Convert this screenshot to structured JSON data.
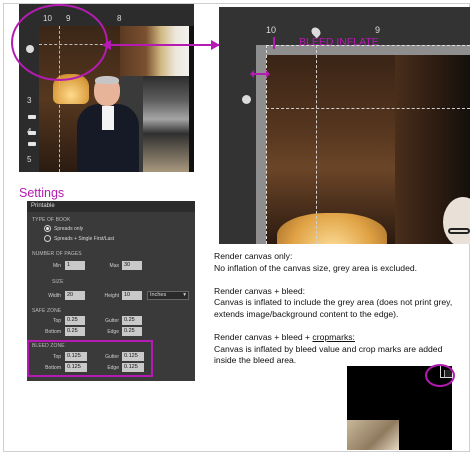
{
  "canvas_preview": {
    "ruler_labels": [
      "10",
      "9",
      "8"
    ],
    "side_labels": [
      "3",
      "4",
      "5"
    ]
  },
  "zoom_preview": {
    "ruler_labels": [
      "10",
      "9"
    ],
    "bleed_label": "BLEED INFLATE"
  },
  "settings": {
    "heading": "Settings",
    "panel_title": "Printable",
    "type_section": "TYPE OF BOOK",
    "type_options": [
      "Spreads only",
      "Spreads + Single First/Last"
    ],
    "pages_section": "NUMBER OF PAGES",
    "min_label": "Min",
    "min_value": "1",
    "max_label": "Max",
    "max_value": "30",
    "size_section": "SIZE",
    "width_label": "Width",
    "width_value": "20",
    "height_label": "Height",
    "height_value": "10",
    "unit_value": "Inches",
    "safe_section": "SAFE ZONE",
    "safe": {
      "top_label": "Top",
      "top_value": "0.25",
      "gutter_label": "Gutter",
      "gutter_value": "0.25",
      "bottom_label": "Bottom",
      "bottom_value": "0.25",
      "edge_label": "Edge",
      "edge_value": "0.25"
    },
    "bleed_section": "BLEED ZONE",
    "bleed": {
      "top_label": "Top",
      "top_value": "0.125",
      "gutter_label": "Gutter",
      "gutter_value": "0.125",
      "bottom_label": "Bottom",
      "bottom_value": "0.125",
      "edge_label": "Edge",
      "edge_value": "0.125"
    }
  },
  "notes": {
    "n1_title": "Render canvas only:",
    "n1_body": "No inflation of the canvas size, grey area is excluded.",
    "n2_title": "Render canvas + bleed:",
    "n2_body": "Canvas is inflated to include the grey area (does not print grey, extends image/background content to the edge).",
    "n3_title_a": "Render canvas + bleed + ",
    "n3_title_b": "cropmarks:",
    "n3_body": "Canvas is inflated by bleed value and crop marks are added inside the bleed area."
  },
  "colors": {
    "annotation": "#b51bb3",
    "panel_bg": "#3a3a3a"
  }
}
